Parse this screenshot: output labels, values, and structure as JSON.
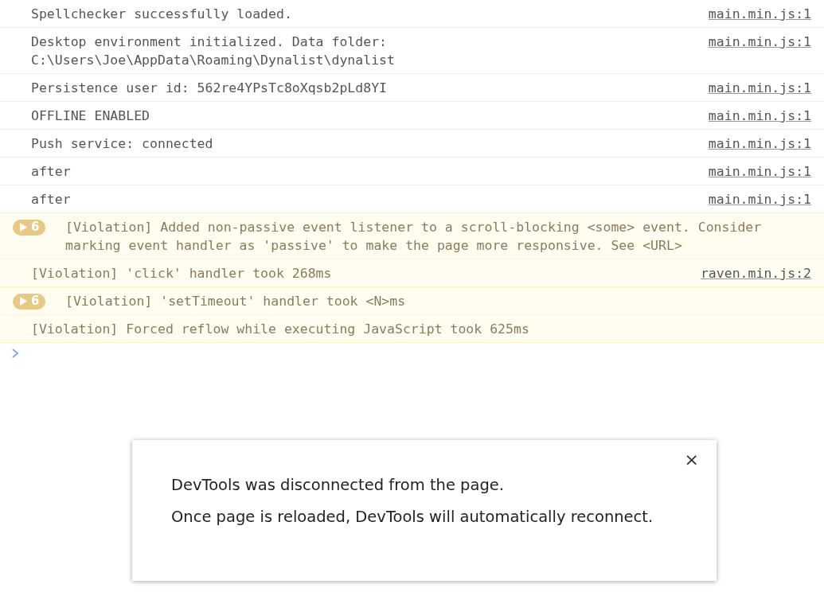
{
  "console": {
    "messages": [
      {
        "kind": "log",
        "lines": [
          "Spellchecker successfully loaded."
        ],
        "source": "main.min.js:1"
      },
      {
        "kind": "log",
        "lines": [
          "Desktop environment initialized. Data folder:",
          "C:\\Users\\Joe\\AppData\\Roaming\\Dynalist\\dynalist"
        ],
        "source": "main.min.js:1"
      },
      {
        "kind": "log",
        "lines": [
          "Persistence user id: 562re4YPsTc8oXqsb2pLd8YI"
        ],
        "source": "main.min.js:1"
      },
      {
        "kind": "log",
        "lines": [
          "OFFLINE ENABLED"
        ],
        "source": "main.min.js:1"
      },
      {
        "kind": "log",
        "lines": [
          "Push service: connected"
        ],
        "source": "main.min.js:1"
      },
      {
        "kind": "log",
        "lines": [
          "after"
        ],
        "source": "main.min.js:1"
      },
      {
        "kind": "log",
        "lines": [
          "after"
        ],
        "source": "main.min.js:1"
      },
      {
        "kind": "violation",
        "count": "6",
        "lines": [
          "[Violation] Added non-passive event listener to a scroll-blocking <some> event. Consider",
          "marking event handler as 'passive' to make the page more responsive. See <URL>"
        ]
      },
      {
        "kind": "violation",
        "lines": [
          "[Violation] 'click' handler took 268ms"
        ],
        "source": "raven.min.js:2"
      },
      {
        "kind": "violation",
        "count": "6",
        "lines": [
          "[Violation] 'setTimeout' handler took <N>ms"
        ]
      },
      {
        "kind": "violation",
        "lines": [
          "[Violation] Forced reflow while executing JavaScript took 625ms"
        ]
      }
    ]
  },
  "dialog": {
    "close": "×",
    "messages": [
      "DevTools was disconnected from the page.",
      "Once page is reloaded, DevTools will automatically reconnect."
    ]
  }
}
